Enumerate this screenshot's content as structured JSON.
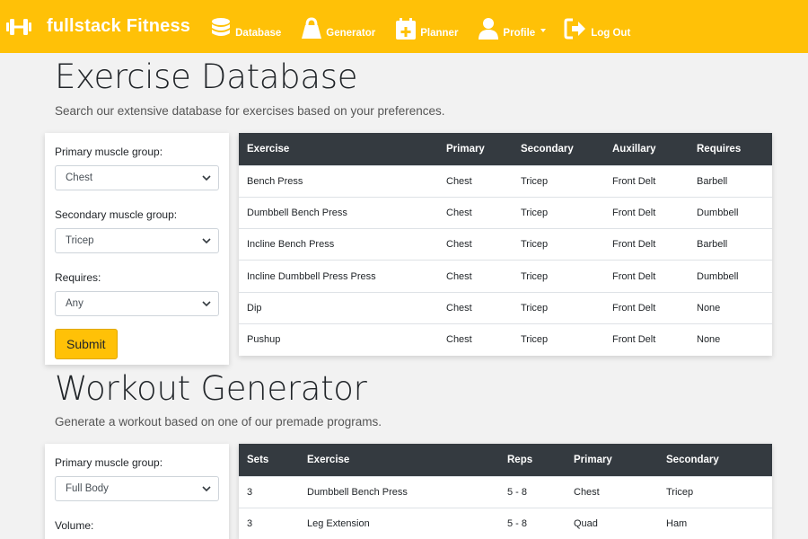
{
  "colors": {
    "accent": "#ffc107",
    "table_header": "#343a40"
  },
  "navbar": {
    "brand": "fullstack Fitness",
    "brand_icon": "dumbbell-icon",
    "items": [
      {
        "label": "Database",
        "icon": "database-icon"
      },
      {
        "label": "Generator",
        "icon": "kettlebell-icon"
      },
      {
        "label": "Planner",
        "icon": "calendar-plus-icon"
      },
      {
        "label": "Profile",
        "icon": "user-icon",
        "dropdown": true
      },
      {
        "label": "Log Out",
        "icon": "sign-out-icon"
      }
    ]
  },
  "database": {
    "title": "Exercise Database",
    "subtitle": "Search our extensive database for exercises based on your preferences.",
    "form": {
      "primary_label": "Primary muscle group:",
      "primary_value": "Chest",
      "secondary_label": "Secondary muscle group:",
      "secondary_value": "Tricep",
      "requires_label": "Requires:",
      "requires_value": "Any",
      "submit_label": "Submit"
    },
    "table": {
      "headers": [
        "Exercise",
        "Primary",
        "Secondary",
        "Auxillary",
        "Requires"
      ],
      "rows": [
        [
          "Bench Press",
          "Chest",
          "Tricep",
          "Front Delt",
          "Barbell"
        ],
        [
          "Dumbbell Bench Press",
          "Chest",
          "Tricep",
          "Front Delt",
          "Dumbbell"
        ],
        [
          "Incline Bench Press",
          "Chest",
          "Tricep",
          "Front Delt",
          "Barbell"
        ],
        [
          "Incline Dumbbell Press Press",
          "Chest",
          "Tricep",
          "Front Delt",
          "Dumbbell"
        ],
        [
          "Dip",
          "Chest",
          "Tricep",
          "Front Delt",
          "None"
        ],
        [
          "Pushup",
          "Chest",
          "Tricep",
          "Front Delt",
          "None"
        ]
      ]
    }
  },
  "generator": {
    "title": "Workout Generator",
    "subtitle": "Generate a workout based on one of our premade programs.",
    "form": {
      "primary_label": "Primary muscle group:",
      "primary_value": "Full Body",
      "volume_label": "Volume:"
    },
    "table": {
      "headers": [
        "Sets",
        "Exercise",
        "Reps",
        "Primary",
        "Secondary"
      ],
      "rows": [
        [
          "3",
          "Dumbbell Bench Press",
          "5 - 8",
          "Chest",
          "Tricep"
        ],
        [
          "3",
          "Leg Extension",
          "5 - 8",
          "Quad",
          "Ham"
        ]
      ]
    }
  }
}
